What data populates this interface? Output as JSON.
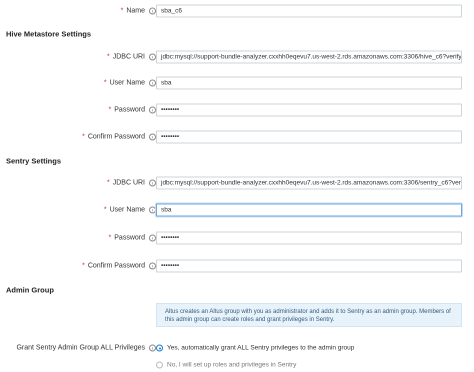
{
  "fields": {
    "name": {
      "label": "Name",
      "value": "sba_c6"
    },
    "hive": {
      "jdbc_label": "JDBC URI",
      "jdbc_value": "jdbc:mysql://support-bundle-analyzer.cxxhh0eqevu7.us-west-2.rds.amazonaws.com:3306/hive_c6?verifySer",
      "user_label": "User Name",
      "user_value": "sba",
      "password_label": "Password",
      "password_value": "••••••••",
      "confirm_label": "Confirm Password",
      "confirm_value": "••••••••"
    },
    "sentry": {
      "jdbc_label": "JDBC URI",
      "jdbc_value": "jdbc:mysql://support-bundle-analyzer.cxxhh0eqevu7.us-west-2.rds.amazonaws.com:3306/sentry_c6?verifySe",
      "user_label": "User Name",
      "user_value": "sba",
      "password_label": "Password",
      "password_value": "••••••••",
      "confirm_label": "Confirm Password",
      "confirm_value": "••••••••"
    }
  },
  "sections": {
    "hive": "Hive Metastore Settings",
    "sentry": "Sentry Settings",
    "admin": "Admin Group"
  },
  "admin": {
    "note": "Altus creates an Altus group with you as administrator and adds it to Sentry as an admin group. Members of this admin group can create roles and grant privileges in Sentry.",
    "grant_label": "Grant Sentry Admin Group ALL Privileges",
    "option_yes": "Yes, automatically grant ALL Sentry privileges to the admin group",
    "option_no": "No, I will set up roles and privileges in Sentry"
  },
  "icons": {
    "info": "info-icon",
    "radio": "radio-icon"
  },
  "colors": {
    "required": "#c0392b",
    "accent": "#1f7ad1",
    "note_bg": "#e8f2fb"
  }
}
